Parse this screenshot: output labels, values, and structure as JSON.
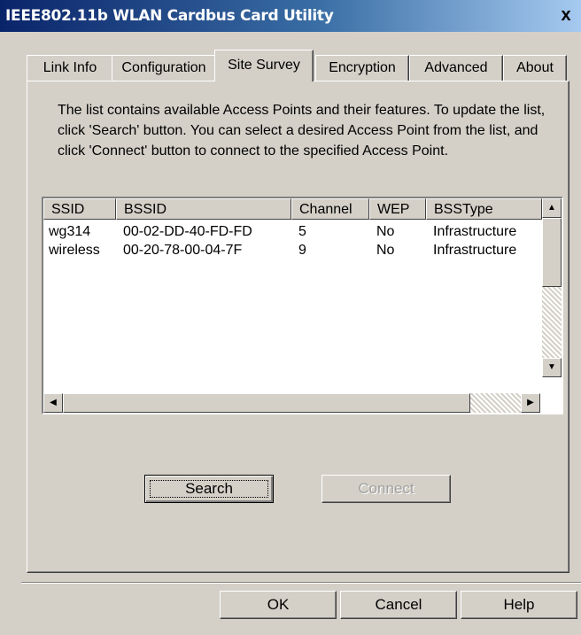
{
  "window": {
    "title": "IEEE802.11b WLAN Cardbus Card Utility",
    "close_glyph": "x"
  },
  "tabs": [
    {
      "label": "Link Info"
    },
    {
      "label": "Configuration"
    },
    {
      "label": "Site Survey",
      "active": true
    },
    {
      "label": "Encryption"
    },
    {
      "label": "Advanced"
    },
    {
      "label": "About"
    }
  ],
  "site_survey": {
    "description": "The list contains available Access Points and their features. To update the list, click 'Search' button. You can select a desired Access Point from the list, and click 'Connect' button to connect to the specified Access Point.",
    "columns": [
      "SSID",
      "BSSID",
      "Channel",
      "WEP",
      "BSSType"
    ],
    "rows": [
      [
        "wg314",
        "00-02-DD-40-FD-FD",
        "5",
        "No",
        "Infrastructure"
      ],
      [
        "wireless",
        "00-20-78-00-04-7F",
        "9",
        "No",
        "Infrastructure"
      ]
    ],
    "search_label": "Search",
    "connect_label": "Connect"
  },
  "footer": {
    "ok_label": "OK",
    "cancel_label": "Cancel",
    "help_label": "Help"
  },
  "icons": {
    "scroll_up": "up-arrow-icon",
    "scroll_down": "down-arrow-icon",
    "scroll_left": "left-arrow-icon",
    "scroll_right": "right-arrow-icon"
  },
  "colors": {
    "titlebar_start": "#0a246a",
    "titlebar_end": "#a6caf0",
    "face": "#d4d0c8"
  }
}
